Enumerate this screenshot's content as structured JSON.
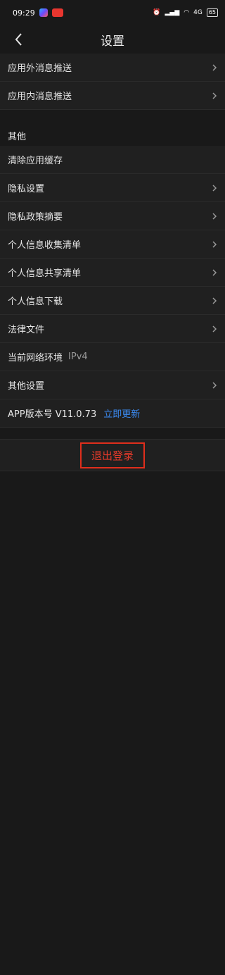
{
  "status": {
    "time": "09:29",
    "network": "4G",
    "battery": "65"
  },
  "header": {
    "title": "设置"
  },
  "items_top": [
    {
      "label": "应用外消息推送"
    },
    {
      "label": "应用内消息推送"
    }
  ],
  "section": {
    "title": "其他"
  },
  "items_other": [
    {
      "label": "清除应用缓存",
      "chevron": false
    },
    {
      "label": "隐私设置",
      "chevron": true
    },
    {
      "label": "隐私政策摘要",
      "chevron": true
    },
    {
      "label": "个人信息收集清单",
      "chevron": true
    },
    {
      "label": "个人信息共享清单",
      "chevron": true
    },
    {
      "label": "个人信息下载",
      "chevron": true
    },
    {
      "label": "法律文件",
      "chevron": true
    }
  ],
  "network_row": {
    "label": "当前网络环境",
    "value": "IPv4"
  },
  "other_settings": {
    "label": "其他设置"
  },
  "version_row": {
    "label": "APP版本号 V11.0.73",
    "link": "立即更新"
  },
  "logout": {
    "label": "退出登录"
  }
}
